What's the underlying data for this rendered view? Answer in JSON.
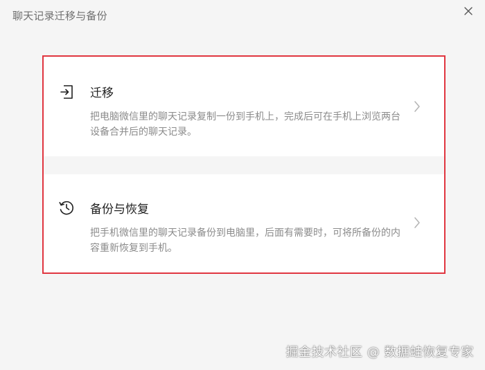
{
  "window": {
    "title": "聊天记录迁移与备份",
    "close_icon": "close-icon"
  },
  "options": [
    {
      "icon": "migrate-icon",
      "title": "迁移",
      "description": "把电脑微信里的聊天记录复制一份到手机上，完成后可在手机上浏览两台设备合并后的聊天记录。",
      "chevron_icon": "chevron-right-icon"
    },
    {
      "icon": "history-icon",
      "title": "备份与恢复",
      "description": "把手机微信里的聊天记录备份到电脑里，后面有需要时，可将所备份的内容重新恢复到手机。",
      "chevron_icon": "chevron-right-icon"
    }
  ],
  "watermark": "掘金技术社区 @ 数据蛙恢复专家",
  "colors": {
    "highlight_border": "#e0353f",
    "background": "#f5f5f5",
    "card": "#ffffff",
    "description_text": "#8b8b8b"
  }
}
